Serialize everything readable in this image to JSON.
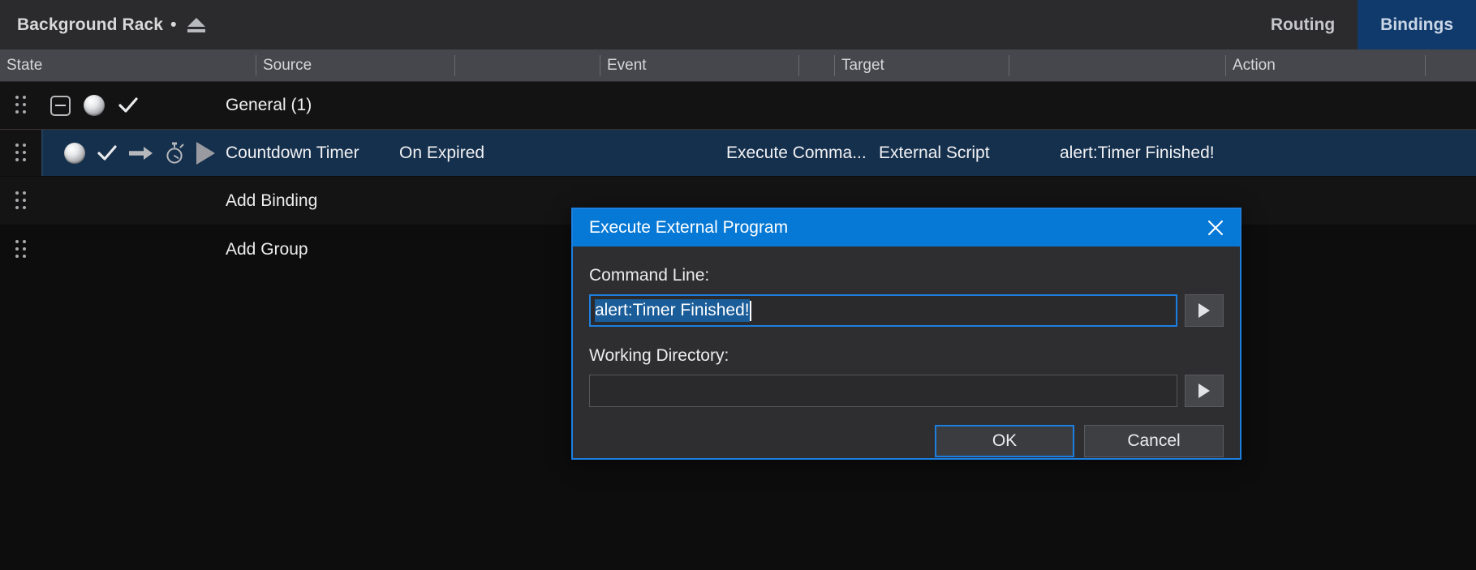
{
  "titlebar": {
    "title": "Background Rack",
    "dot": "•",
    "eject_icon": "eject-icon",
    "tabs": [
      {
        "label": "Routing",
        "active": false
      },
      {
        "label": "Bindings",
        "active": true
      }
    ]
  },
  "columns": [
    {
      "label": "State"
    },
    {
      "label": "Source"
    },
    {
      "label": ""
    },
    {
      "label": "Event"
    },
    {
      "label": ""
    },
    {
      "label": "Target"
    },
    {
      "label": ""
    },
    {
      "label": "Action"
    },
    {
      "label": ""
    }
  ],
  "rows": {
    "group": {
      "title": "General (1)",
      "collapse_icon": "minus-box-icon",
      "led_icon": "led-sphere-icon",
      "check_icon": "checkmark-icon",
      "drag_icon": "drag-handle-icon"
    },
    "binding": {
      "source": "Countdown Timer",
      "event": "On Expired",
      "target": "Execute Comma...",
      "target_detail": "External Script",
      "action": "alert:Timer Finished!",
      "led_icon": "led-sphere-icon",
      "check_icon": "checkmark-icon",
      "arrow_icon": "arrow-right-icon",
      "timer_icon": "stopwatch-icon",
      "play_icon": "play-triangle-icon",
      "drag_icon": "drag-handle-icon"
    },
    "add_binding": {
      "label": "Add Binding",
      "drag_icon": "drag-handle-icon"
    },
    "add_group": {
      "label": "Add Group",
      "drag_icon": "drag-handle-icon"
    }
  },
  "dialog": {
    "title": "Execute External Program",
    "close_icon": "close-icon",
    "command_line": {
      "label": "Command Line:",
      "value": "alert:Timer Finished!",
      "placeholder": "",
      "selected": true,
      "browse_icon": "browse-triangle-icon"
    },
    "working_directory": {
      "label": "Working Directory:",
      "value": "",
      "placeholder": "",
      "browse_icon": "browse-triangle-icon"
    },
    "buttons": {
      "ok": "OK",
      "cancel": "Cancel"
    }
  },
  "colors": {
    "accent_blue": "#0679d6",
    "tab_active": "#103a6b",
    "row_selected": "#15304d",
    "selection_highlight": "#1a5d99",
    "focus_border": "#1c7fe0"
  }
}
